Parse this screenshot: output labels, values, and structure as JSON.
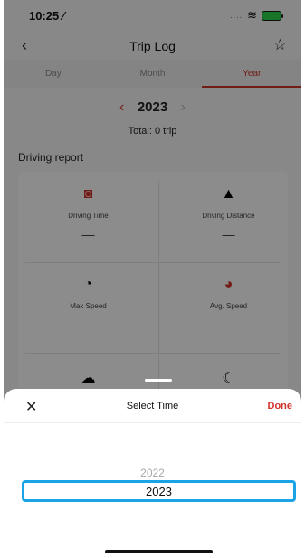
{
  "status_bar": {
    "time": "10:25 ⁄",
    "signal_dots": "....",
    "wifi_glyph": "≋"
  },
  "nav": {
    "back_glyph": "‹",
    "title": "Trip Log",
    "star_glyph": "☆"
  },
  "tabs": [
    {
      "label": "Day",
      "active": false
    },
    {
      "label": "Month",
      "active": false
    },
    {
      "label": "Year",
      "active": true
    }
  ],
  "year_selector": {
    "prev_glyph": "‹",
    "value": "2023",
    "next_glyph": "›"
  },
  "total": "Total: 0 trip",
  "section_title": "Driving report",
  "metrics": [
    {
      "label": "Driving Time",
      "value": "—",
      "icon": "clock-icon",
      "glyph": "◙",
      "color": "#d0342c"
    },
    {
      "label": "Driving Distance",
      "value": "—",
      "icon": "road-icon",
      "glyph": "▲",
      "color": "#333333"
    },
    {
      "label": "Max Speed",
      "value": "—",
      "icon": "speedometer-icon",
      "glyph": "◔",
      "color": "#333333"
    },
    {
      "label": "Avg. Speed",
      "value": "—",
      "icon": "stopwatch-icon",
      "glyph": "◕",
      "color": "#d0342c"
    },
    {
      "label": "",
      "value": "",
      "icon": "weather-icon",
      "glyph": "☁",
      "color": "#333333"
    },
    {
      "label": "",
      "value": "",
      "icon": "night-icon",
      "glyph": "☾",
      "color": "#333333"
    }
  ],
  "sheet": {
    "close_glyph": "✕",
    "title": "Select Time",
    "done_label": "Done",
    "options": [
      "2022",
      "2023"
    ],
    "selected": "2023"
  },
  "colors": {
    "accent": "#d0342c",
    "highlight": "#1aa3e6"
  }
}
